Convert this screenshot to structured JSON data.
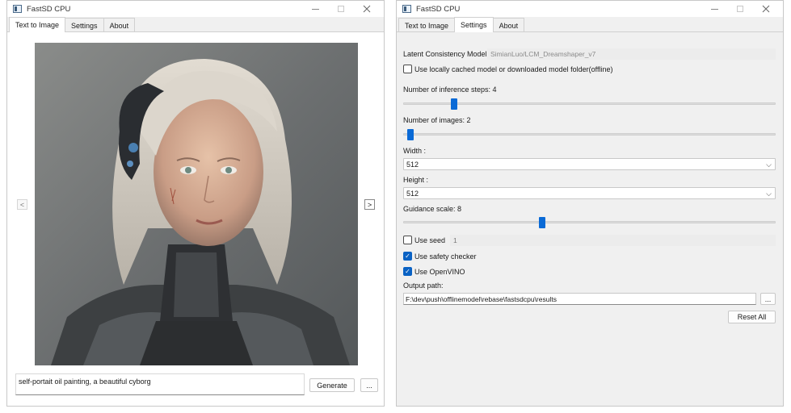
{
  "left_window": {
    "title": "FastSD CPU",
    "tabs": [
      "Text to Image",
      "Settings",
      "About"
    ],
    "active_tab": 0,
    "nav_prev": "<",
    "nav_next": ">",
    "prompt": "self-portait  oil painting, a beautiful cyborg",
    "generate_label": "Generate",
    "more_label": "..."
  },
  "right_window": {
    "title": "FastSD CPU",
    "tabs": [
      "Text to Image",
      "Settings",
      "About"
    ],
    "active_tab": 1,
    "model_label": "Latent Consistency Model:",
    "model_value": "SimianLuo/LCM_Dreamshaper_v7",
    "offline_label": "Use locally cached model or downloaded model folder(offline)",
    "offline_checked": false,
    "steps_label": "Number of inference steps: 4",
    "steps_fraction": 0.13,
    "images_label": "Number of images: 2",
    "images_fraction": 0.01,
    "width_label": "Width :",
    "width_value": "512",
    "height_label": "Height :",
    "height_value": "512",
    "guidance_label": "Guidance scale: 8",
    "guidance_fraction": 0.37,
    "seed_label": "Use seed",
    "seed_checked": false,
    "seed_value": "1",
    "safety_label": "Use safety checker",
    "safety_checked": true,
    "openvino_label": "Use OpenVINO",
    "openvino_checked": true,
    "output_label": "Output path:",
    "output_value": "F:\\dev\\push\\offlinemodel\\rebase\\fastsdcpu\\results",
    "browse_label": "...",
    "reset_label": "Reset All"
  },
  "colors": {
    "accent": "#0a6ad6",
    "checkbox_checked": "#0a62c4",
    "window_bg": "#f0f0f0"
  }
}
